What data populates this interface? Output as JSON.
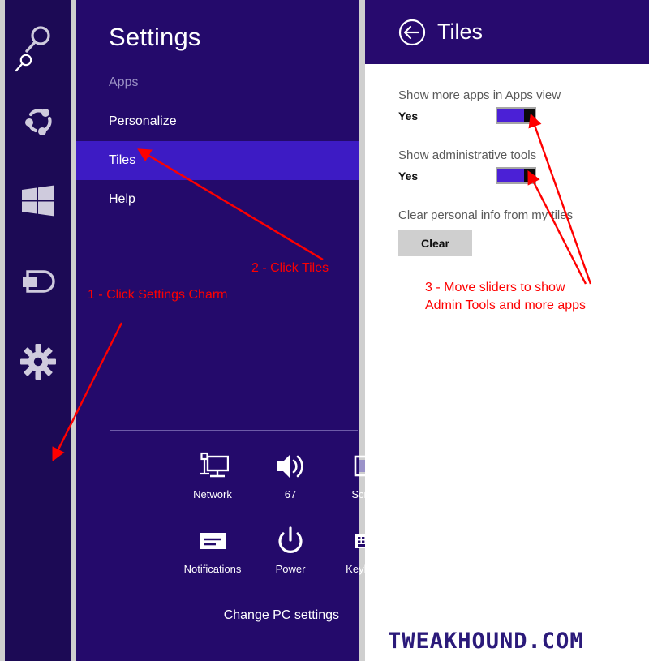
{
  "charms": {
    "items": [
      {
        "name": "search-charm",
        "icon": "search-icon"
      },
      {
        "name": "share-charm",
        "icon": "share-icon"
      },
      {
        "name": "start-charm",
        "icon": "windows-logo-icon"
      },
      {
        "name": "devices-charm",
        "icon": "devices-icon"
      },
      {
        "name": "settings-charm",
        "icon": "gear-icon"
      }
    ]
  },
  "settings": {
    "title": "Settings",
    "nav": [
      {
        "label": "Apps",
        "state": "dim"
      },
      {
        "label": "Personalize",
        "state": "normal"
      },
      {
        "label": "Tiles",
        "state": "selected"
      },
      {
        "label": "Help",
        "state": "normal"
      }
    ],
    "quick": [
      {
        "label": "Network",
        "icon": "network-icon"
      },
      {
        "label": "67",
        "icon": "volume-icon"
      },
      {
        "label": "Screen",
        "icon": "screen-brightness-icon"
      },
      {
        "label": "Notifications",
        "icon": "notifications-icon"
      },
      {
        "label": "Power",
        "icon": "power-icon"
      },
      {
        "label": "Keyboard",
        "icon": "keyboard-icon"
      }
    ],
    "change_pc_settings": "Change PC settings"
  },
  "tiles": {
    "header_title": "Tiles",
    "back_icon": "back-arrow-icon",
    "options": [
      {
        "label": "Show more apps in Apps view",
        "value": "Yes",
        "toggle_on": true
      },
      {
        "label": "Show administrative tools",
        "value": "Yes",
        "toggle_on": true
      }
    ],
    "clear_label": "Clear personal info from my tiles",
    "clear_button": "Clear"
  },
  "annotations": {
    "step1": "1 - Click Settings Charm",
    "step2": "2 - Click Tiles",
    "step3_line1": "3 - Move sliders to show",
    "step3_line2": "Admin Tools and more apps",
    "color": "#fe0000"
  },
  "watermark": "TWEAKHOUND.COM",
  "colors": {
    "charms_bg": "#1c0a55",
    "settings_bg": "#240a6b",
    "selected_nav": "#3d1bc4",
    "tiles_header": "#270a6e",
    "toggle_fill": "#4b20d6",
    "page_bg": "#cfcfcf"
  }
}
